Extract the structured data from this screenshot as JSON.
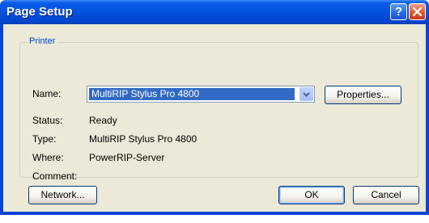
{
  "dialog": {
    "title": "Page Setup",
    "help_button": "?",
    "close_button": "close"
  },
  "printer": {
    "group_label": "Printer",
    "name_label": "Name:",
    "name_value": "MultiRIP Stylus Pro 4800",
    "properties_button": "Properties...",
    "status_label": "Status:",
    "status_value": "Ready",
    "type_label": "Type:",
    "type_value": "MultiRIP Stylus Pro 4800",
    "where_label": "Where:",
    "where_value": "PowerRIP-Server",
    "comment_label": "Comment:",
    "comment_value": ""
  },
  "buttons": {
    "network": "Network...",
    "ok": "OK",
    "cancel": "Cancel"
  },
  "colors": {
    "titlebar": "#0655e0",
    "dialog_bg": "#ece9d8",
    "selection": "#316ac5",
    "group_label": "#0046d5"
  }
}
